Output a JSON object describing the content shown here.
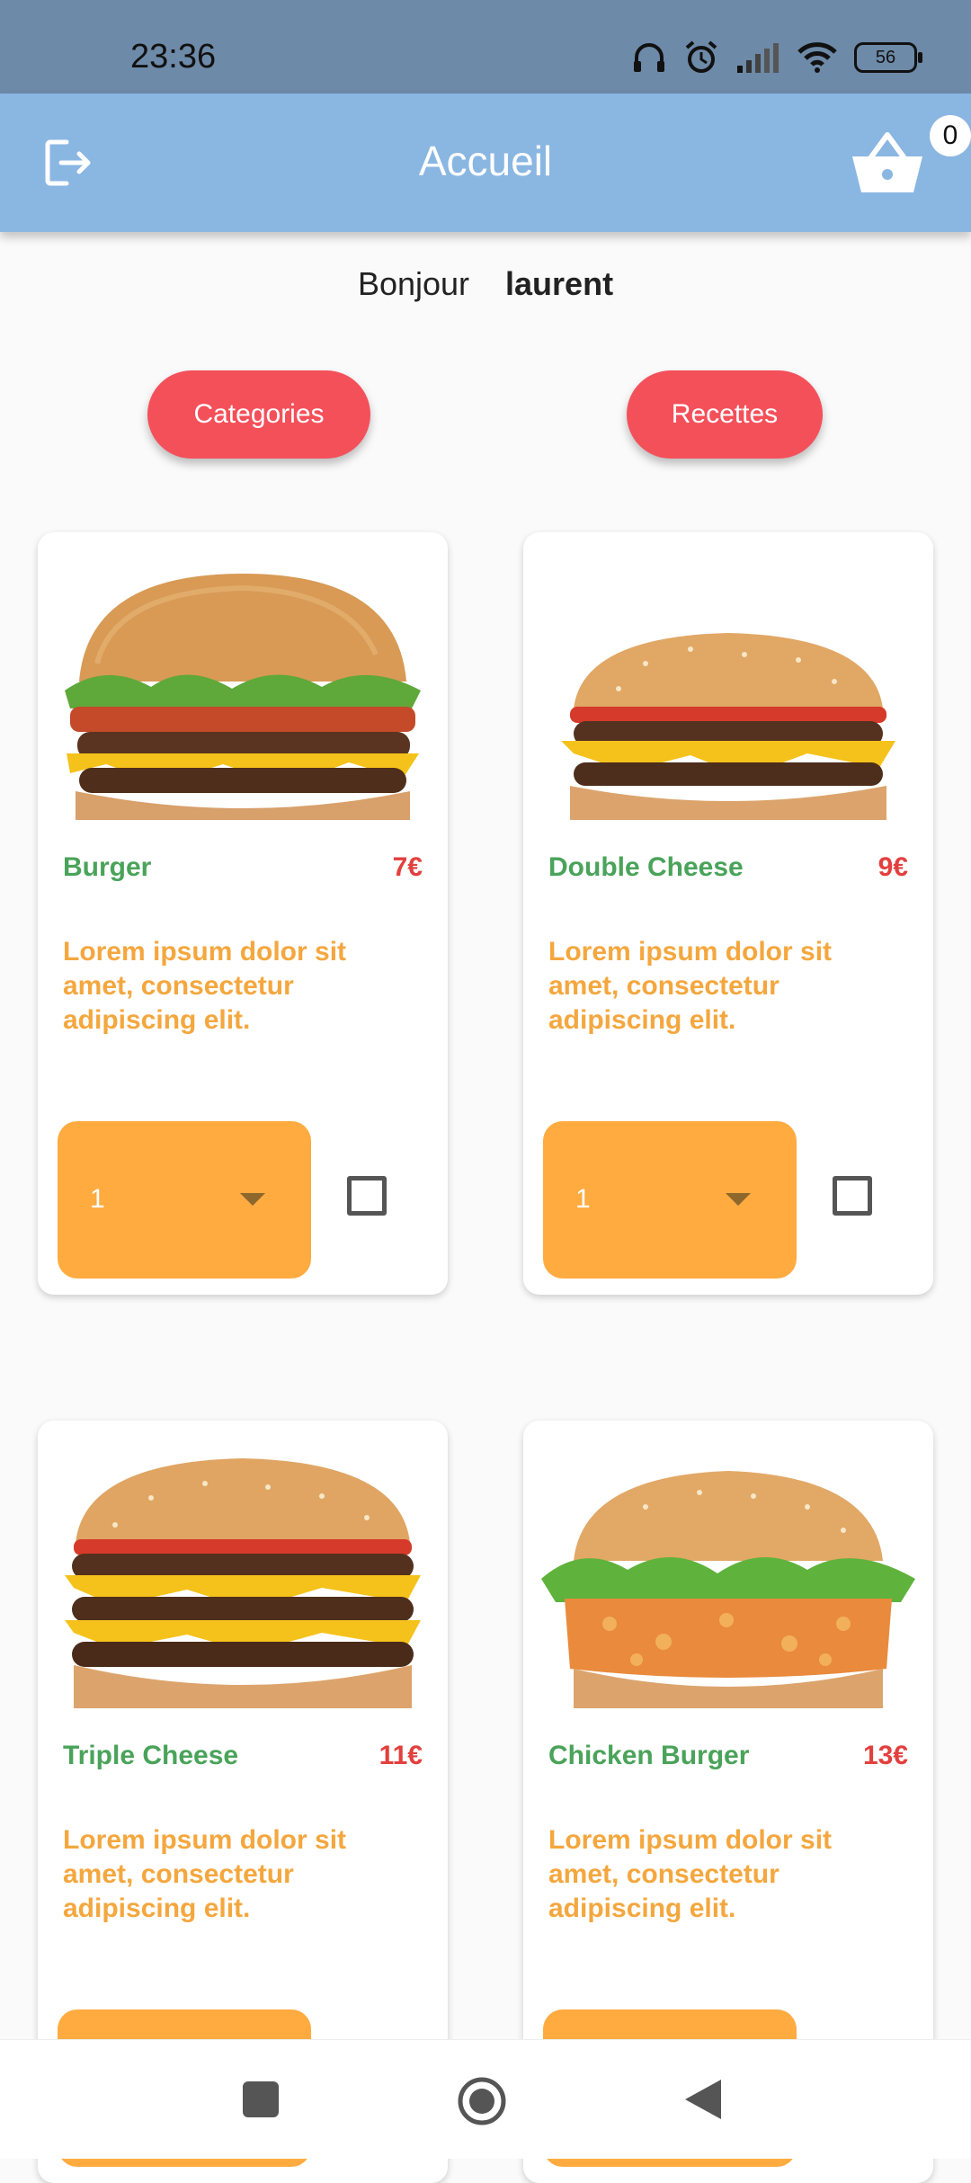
{
  "status": {
    "time": "23:36",
    "battery": "56"
  },
  "appbar": {
    "title": "Accueil",
    "cart_count": "0"
  },
  "greeting": {
    "hello": "Bonjour",
    "user": "laurent"
  },
  "buttons": {
    "categories": "Categories",
    "recipes": "Recettes"
  },
  "products": [
    {
      "name": "Burger",
      "price": "7€",
      "desc": "Lorem ipsum dolor sit amet, consectetur adipiscing elit.",
      "qty": "1"
    },
    {
      "name": "Double Cheese",
      "price": "9€",
      "desc": "Lorem ipsum dolor sit amet, consectetur adipiscing elit.",
      "qty": "1"
    },
    {
      "name": "Triple Cheese",
      "price": "11€",
      "desc": "Lorem ipsum dolor sit amet, consectetur adipiscing elit."
    },
    {
      "name": "Chicken Burger",
      "price": "13€",
      "desc": "Lorem ipsum dolor sit amet, consectetur adipiscing elit."
    }
  ],
  "colors": {
    "appbar": "#8ab6e2",
    "pill": "#f4505a",
    "name_green": "#4aa35a",
    "price_red": "#e2403e",
    "desc_orange": "#f4a73e",
    "qty_orange": "#ffab40"
  }
}
